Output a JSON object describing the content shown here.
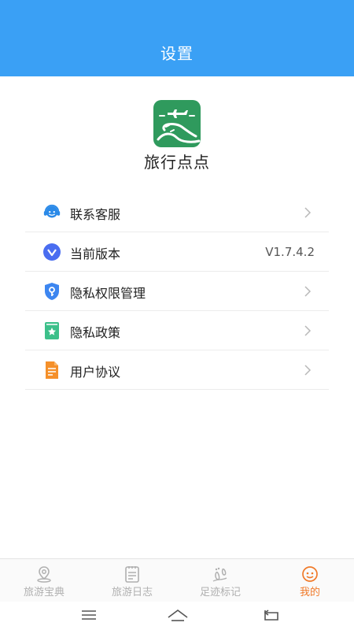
{
  "header": {
    "title": "设置"
  },
  "app": {
    "name": "旅行点点",
    "logo_icon": "plane-road-logo-icon",
    "logo_color": "#2f9a5d"
  },
  "menu": {
    "items": [
      {
        "label": "联系客服",
        "icon": "customer-service-icon",
        "has_chevron": true
      },
      {
        "label": "当前版本",
        "icon": "version-icon",
        "value": "V1.7.4.2",
        "has_chevron": false
      },
      {
        "label": "隐私权限管理",
        "icon": "privacy-shield-icon",
        "has_chevron": true
      },
      {
        "label": "隐私政策",
        "icon": "privacy-policy-icon",
        "has_chevron": true
      },
      {
        "label": "用户协议",
        "icon": "user-agreement-icon",
        "has_chevron": true
      }
    ]
  },
  "tabbar": {
    "tabs": [
      {
        "label": "旅游宝典",
        "icon": "location-pin-icon",
        "active": false
      },
      {
        "label": "旅游日志",
        "icon": "notebook-icon",
        "active": false
      },
      {
        "label": "足迹标记",
        "icon": "footprint-icon",
        "active": false
      },
      {
        "label": "我的",
        "icon": "profile-icon",
        "active": true
      }
    ],
    "active_color": "#f07a2a",
    "inactive_color": "#b0b0b0"
  },
  "system_nav": {
    "buttons": [
      "menu-icon",
      "home-icon",
      "back-icon"
    ]
  },
  "colors": {
    "header_bg": "#3aa0f5"
  }
}
